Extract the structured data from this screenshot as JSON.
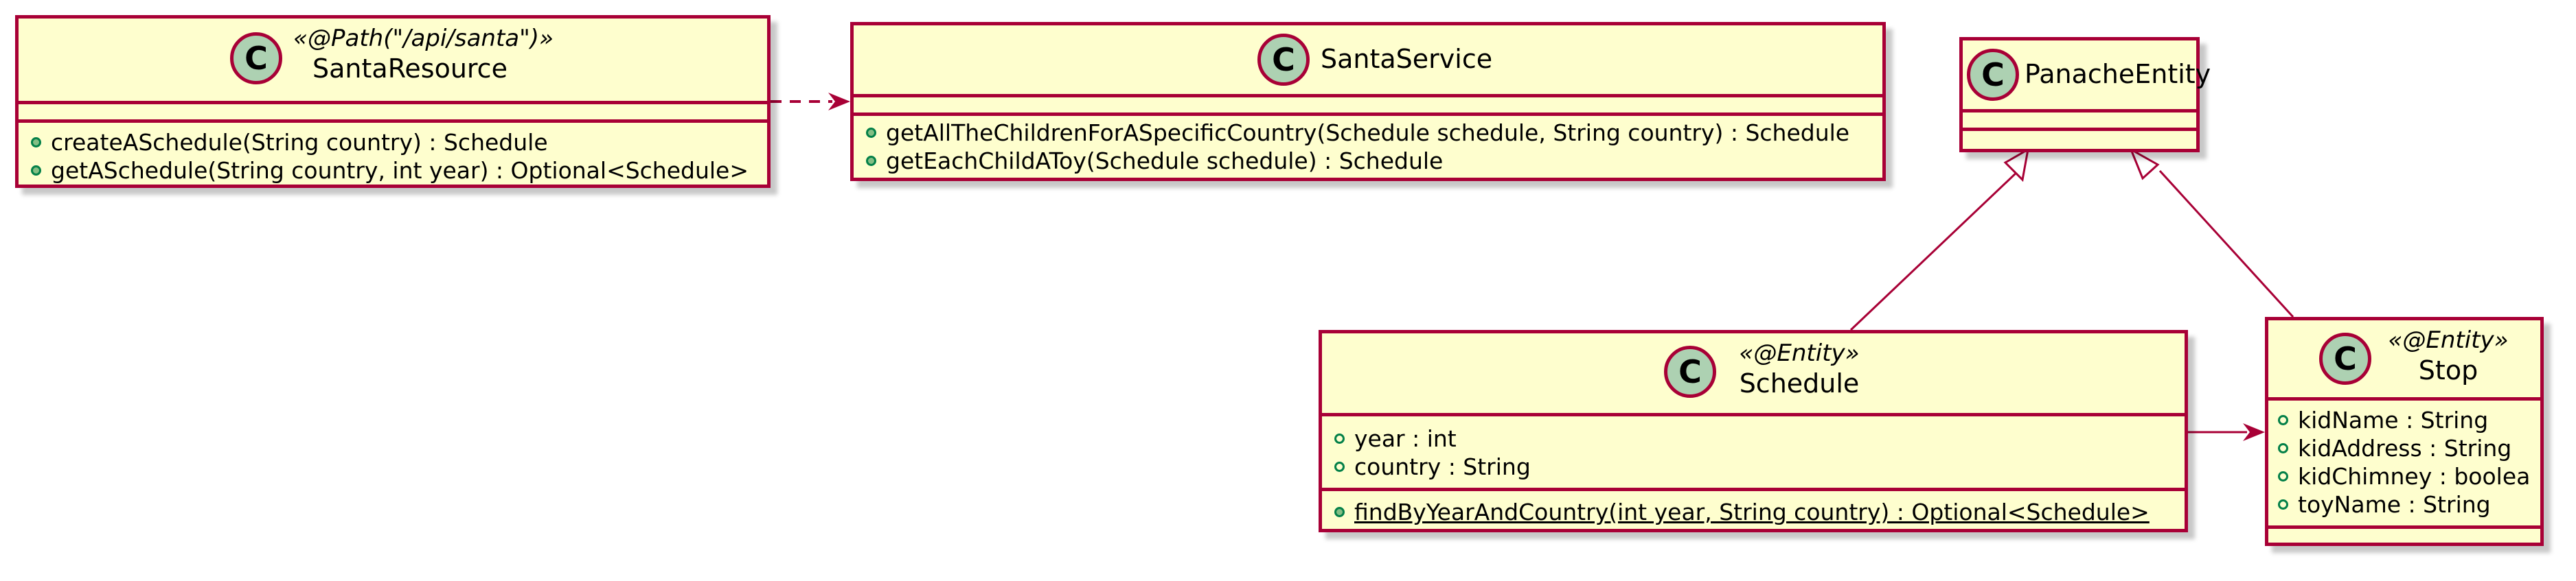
{
  "colors": {
    "border": "#a80036",
    "fill": "#fefece",
    "badge": "#add1b2",
    "visibility": "#038048"
  },
  "classes": {
    "santa_resource": {
      "badge": "C",
      "stereotype": "«@Path(\"/api/santa\")»",
      "name": "SantaResource",
      "methods": [
        "createASchedule(String country) : Schedule",
        "getASchedule(String country, int year) : Optional<Schedule>"
      ]
    },
    "santa_service": {
      "badge": "C",
      "name": "SantaService",
      "methods": [
        "getAllTheChildrenForASpecificCountry(Schedule schedule, String country) : Schedule",
        "getEachChildAToy(Schedule schedule) : Schedule"
      ]
    },
    "panache_entity": {
      "badge": "C",
      "name": "PanacheEntity"
    },
    "schedule": {
      "badge": "C",
      "stereotype": "«@Entity»",
      "name": "Schedule",
      "fields": [
        "year : int",
        "country : String"
      ],
      "methods": [
        "findByYearAndCountry(int year, String country) : Optional<Schedule>"
      ]
    },
    "stop": {
      "badge": "C",
      "stereotype": "«@Entity»",
      "name": "Stop",
      "fields": [
        "kidName : String",
        "kidAddress : String",
        "kidChimney : boolea",
        "toyName : String"
      ]
    }
  },
  "relations": [
    {
      "from": "SantaResource",
      "to": "SantaService",
      "kind": "dependency"
    },
    {
      "from": "Schedule",
      "to": "PanacheEntity",
      "kind": "generalization"
    },
    {
      "from": "Stop",
      "to": "PanacheEntity",
      "kind": "generalization"
    },
    {
      "from": "Schedule",
      "to": "Stop",
      "kind": "association"
    }
  ]
}
